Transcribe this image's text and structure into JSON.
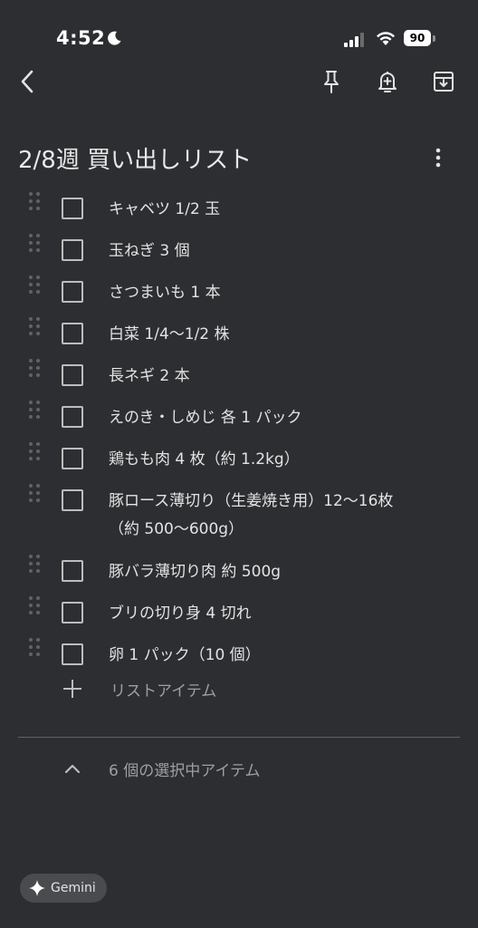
{
  "status_bar": {
    "time": "4:52",
    "battery": "90"
  },
  "note": {
    "title": "2/8週 買い出しリスト"
  },
  "items": [
    {
      "text": "キャベツ 1/2 玉"
    },
    {
      "text": "玉ねぎ 3 個"
    },
    {
      "text": "さつまいも 1 本"
    },
    {
      "text": "白菜 1/4〜1/2 株"
    },
    {
      "text": "長ネギ 2 本"
    },
    {
      "text": "えのき・しめじ 各 1 パック"
    },
    {
      "text": "鶏もも肉 4 枚（約 1.2kg）"
    },
    {
      "text": "豚ロース薄切り（生姜焼き用）12〜16枚（約 500〜600g）"
    },
    {
      "text": "豚バラ薄切り肉 約 500g"
    },
    {
      "text": "ブリの切り身 4 切れ"
    },
    {
      "text": "卵 1 パック（10 個）"
    }
  ],
  "add_item_label": "リストアイテム",
  "checked_items_label": "6 個の選択中アイテム",
  "gemini_label": "Gemini",
  "colors": {
    "background": "#2d2e31",
    "text": "#e3e3e3",
    "muted": "#9aa0a6"
  }
}
